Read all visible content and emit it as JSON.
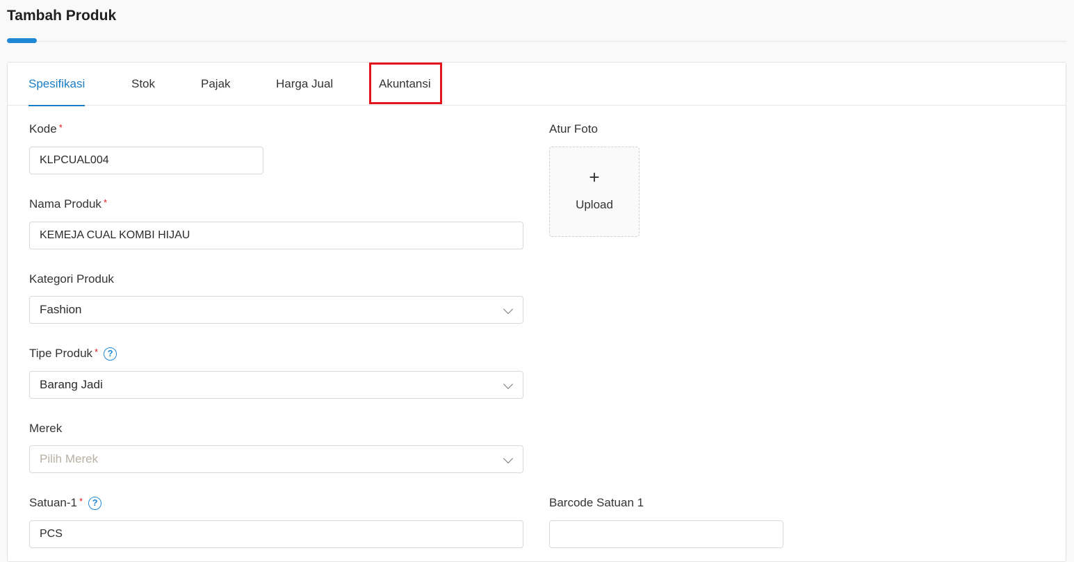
{
  "page": {
    "title": "Tambah Produk"
  },
  "tabs": [
    {
      "label": "Spesifikasi",
      "active": true
    },
    {
      "label": "Stok",
      "active": false
    },
    {
      "label": "Pajak",
      "active": false
    },
    {
      "label": "Harga Jual",
      "active": false
    },
    {
      "label": "Akuntansi",
      "active": false,
      "highlighted": true
    }
  ],
  "form": {
    "kode": {
      "label": "Kode",
      "required_mark": "*",
      "value": "KLPCUAL004"
    },
    "nama_produk": {
      "label": "Nama Produk",
      "required_mark": "*",
      "value": "KEMEJA CUAL KOMBI HIJAU"
    },
    "kategori_produk": {
      "label": "Kategori Produk",
      "value": "Fashion"
    },
    "tipe_produk": {
      "label": "Tipe Produk",
      "required_mark": "*",
      "help_icon": "?",
      "value": "Barang Jadi"
    },
    "merek": {
      "label": "Merek",
      "placeholder": "Pilih Merek"
    },
    "satuan_1": {
      "label": "Satuan-1",
      "required_mark": "*",
      "help_icon": "?",
      "value": "PCS"
    },
    "barcode_satuan_1": {
      "label": "Barcode Satuan 1",
      "value": ""
    },
    "atur_foto": {
      "label": "Atur Foto",
      "upload_icon": "+",
      "upload_label": "Upload"
    }
  },
  "colors": {
    "accent": "#1a7cc4",
    "required": "#e3141b",
    "highlight_box": "#e3141b"
  }
}
